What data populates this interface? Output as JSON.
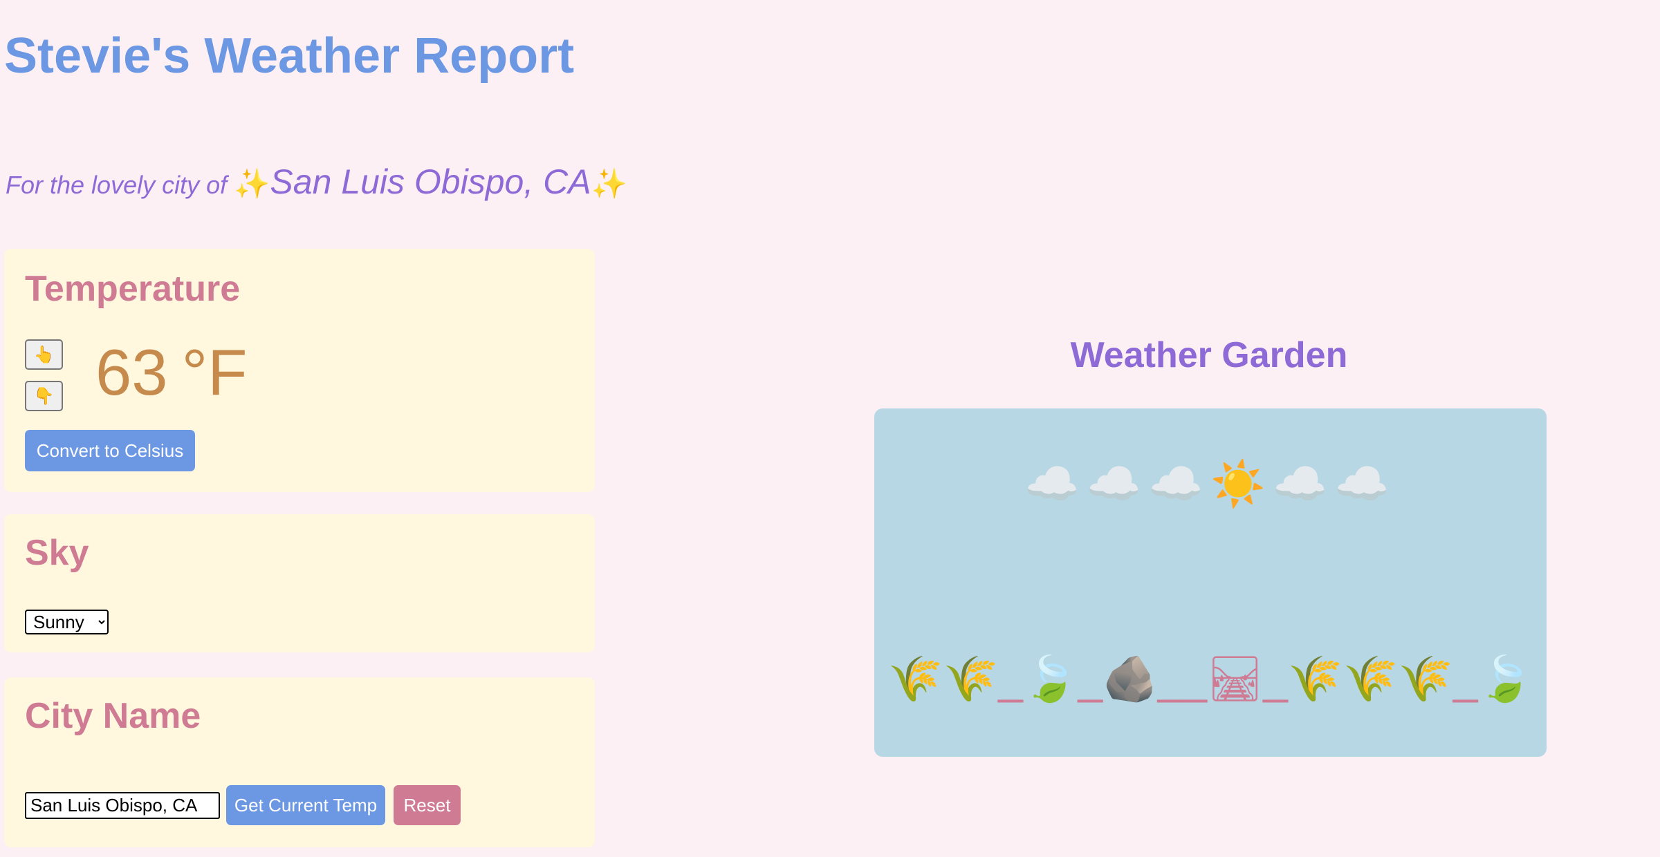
{
  "header": {
    "title": "Stevie's Weather Report",
    "subtitle_prefix": "For the lovely city of ",
    "sparkle": "✨",
    "city": "San Luis Obispo, CA"
  },
  "temperature": {
    "heading": "Temperature",
    "up_icon": "👆",
    "down_icon": "👇",
    "value": "63",
    "unit": "°F",
    "convert_label": "Convert to Celsius"
  },
  "sky": {
    "heading": "Sky",
    "selected": "Sunny"
  },
  "city_name": {
    "heading": "City Name",
    "input_value": "San Luis Obispo, CA",
    "get_temp_label": "Get Current Temp",
    "reset_label": "Reset"
  },
  "garden": {
    "heading": "Weather Garden",
    "sky_emoji": "☁️☁️☁️☀️☁️☁️",
    "landscape_emoji": "🌾🌾_🍃_🪨__🛤_🌾🌾🌾_🍃"
  },
  "colors": {
    "title_blue": "#6b97e3",
    "subtitle_purple": "#8e6ad6",
    "heading_pink": "#cf7b94",
    "card_bg": "#fff8de",
    "page_bg": "#fdf0f4",
    "garden_bg": "#b6d7e3",
    "temp_color": "#c58a4c"
  }
}
